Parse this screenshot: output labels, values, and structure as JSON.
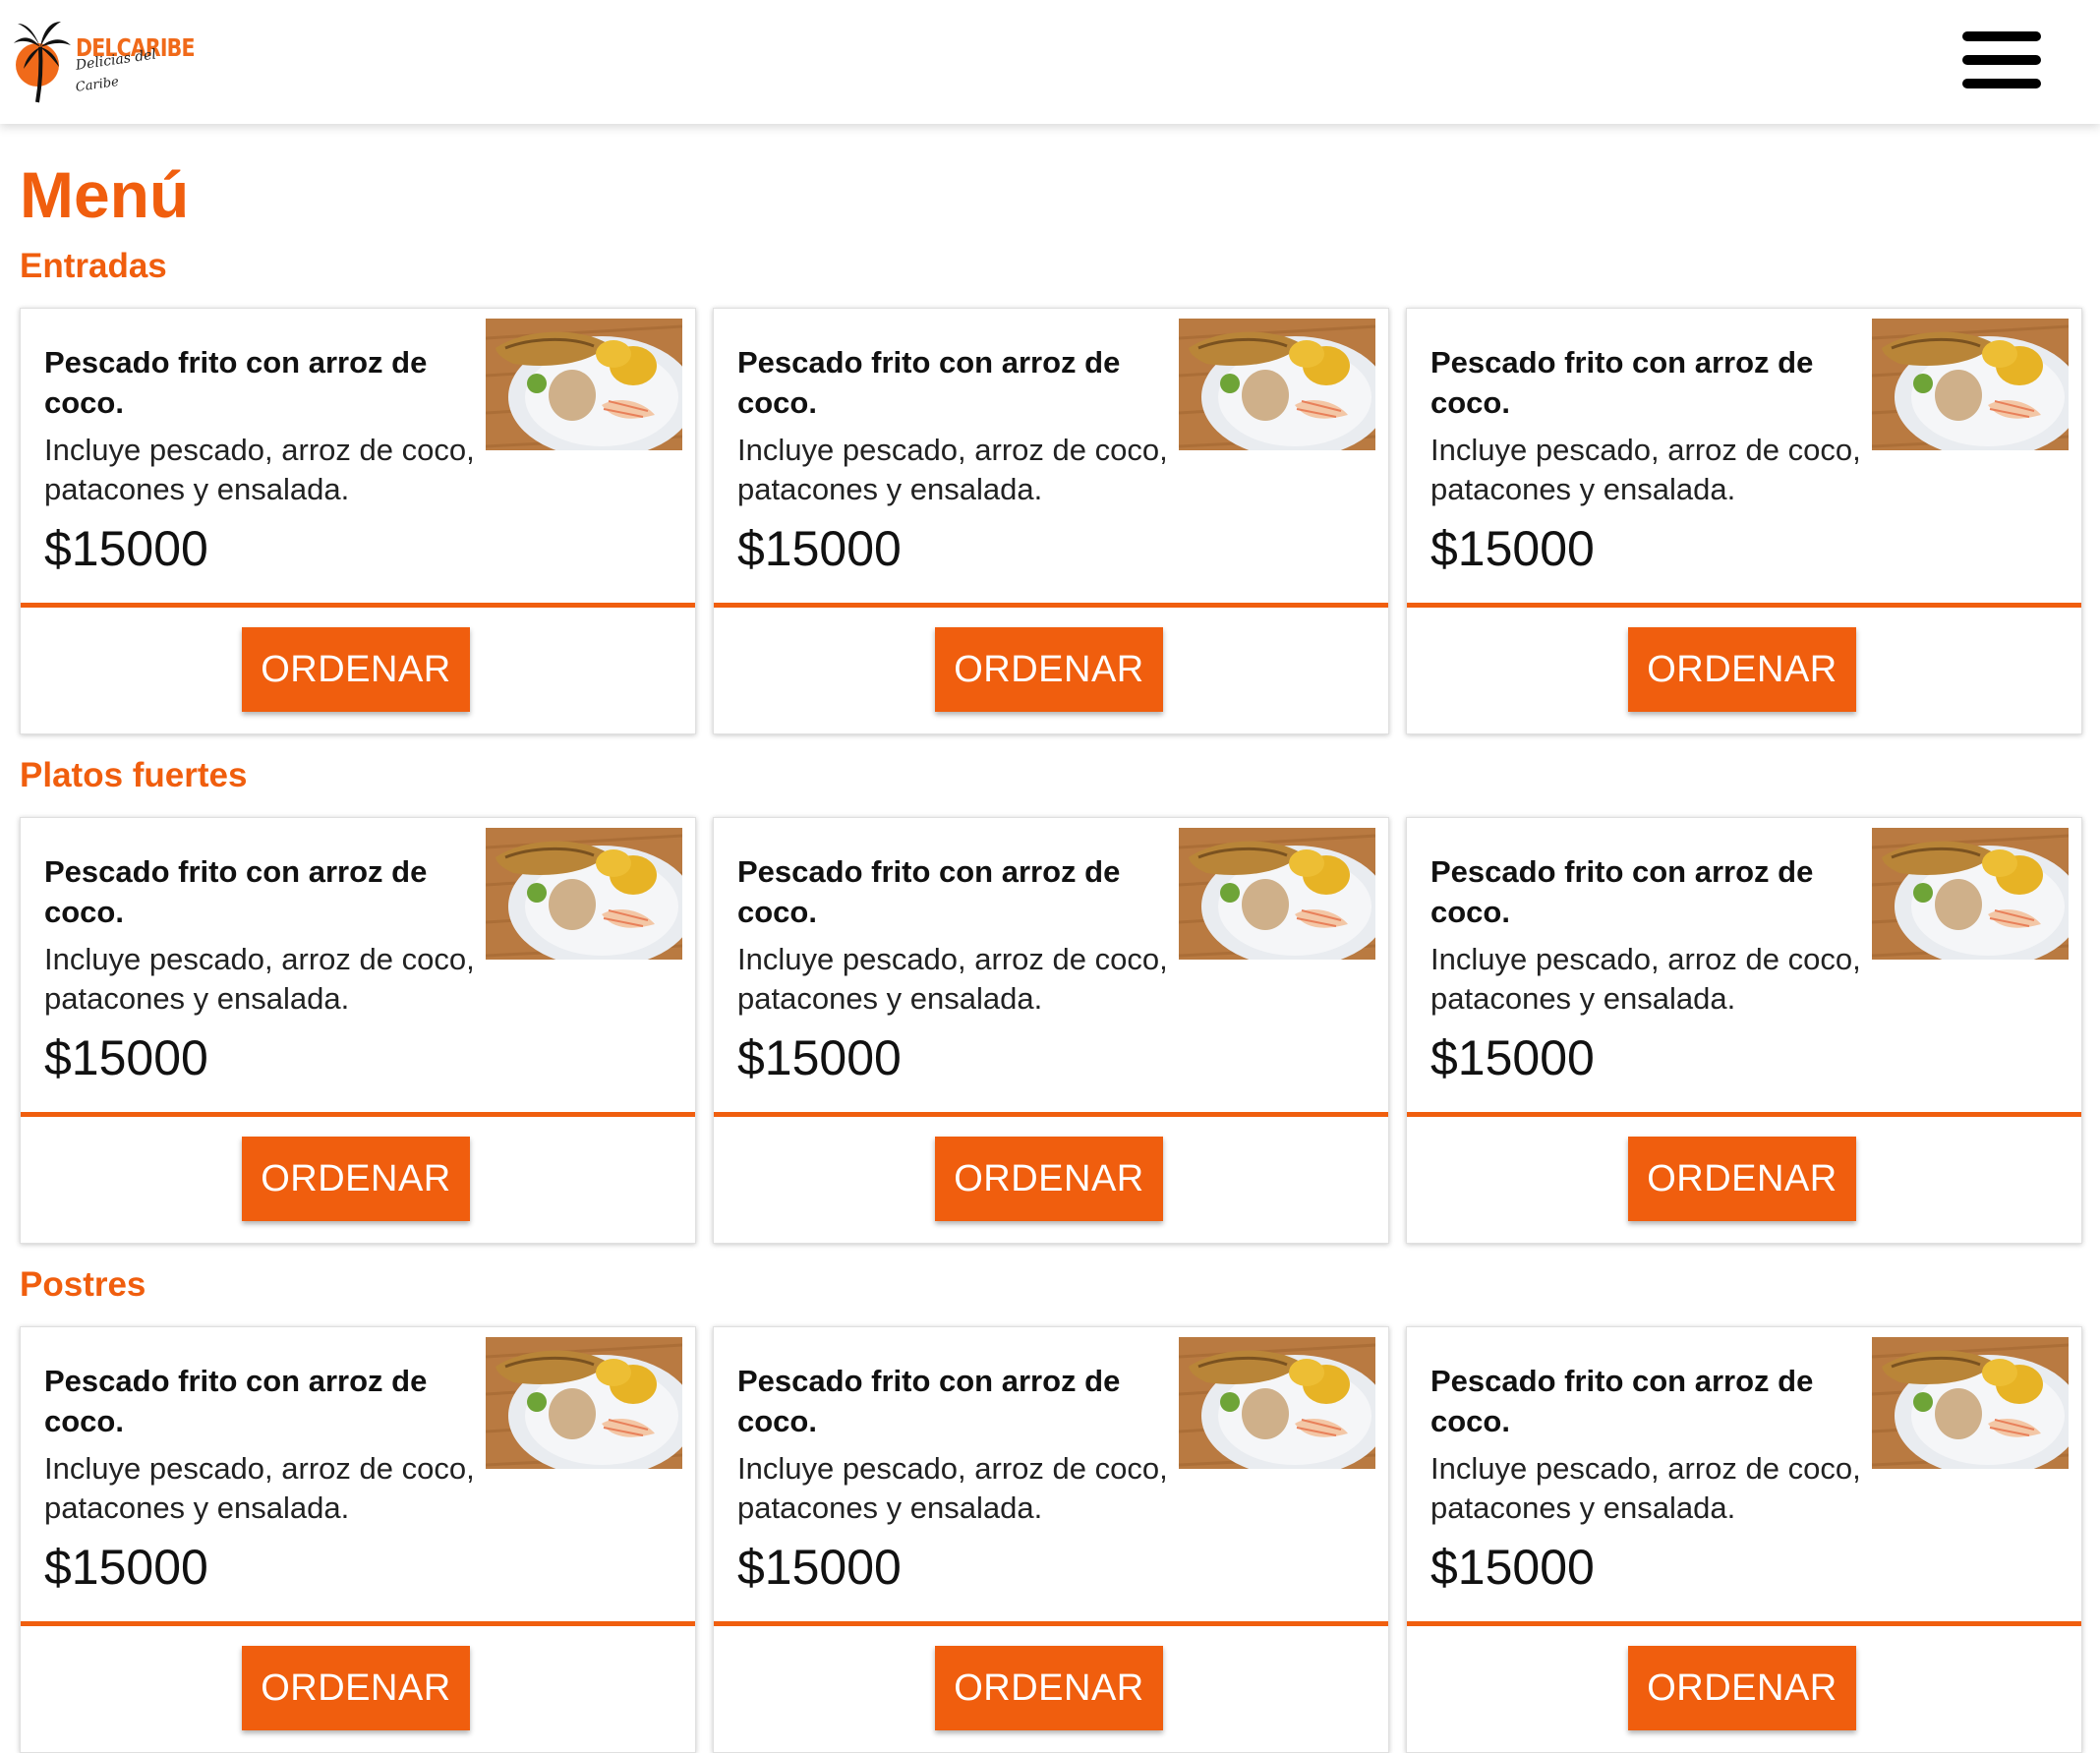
{
  "header": {
    "logo": {
      "brand": "DELCARIBE",
      "tagline_line1": "Delicias del",
      "tagline_line2": "Caribe"
    },
    "menu_icon": "hamburger-icon"
  },
  "page": {
    "title": "Menú"
  },
  "colors": {
    "accent": "#f05e0e",
    "logo_orange": "#f06a1a"
  },
  "sections": [
    {
      "title": "Entradas",
      "items": [
        {
          "name": "Pescado frito con arroz de coco.",
          "description": "Incluye pescado, arroz de coco, patacones y ensalada.",
          "price": "$15000",
          "button": "ORDENAR"
        },
        {
          "name": "Pescado frito con arroz de coco.",
          "description": "Incluye pescado, arroz de coco, patacones y ensalada.",
          "price": "$15000",
          "button": "ORDENAR"
        },
        {
          "name": "Pescado frito con arroz de coco.",
          "description": "Incluye pescado, arroz de coco, patacones y ensalada.",
          "price": "$15000",
          "button": "ORDENAR"
        }
      ]
    },
    {
      "title": "Platos fuertes",
      "items": [
        {
          "name": "Pescado frito con arroz de coco.",
          "description": "Incluye pescado, arroz de coco, patacones y ensalada.",
          "price": "$15000",
          "button": "ORDENAR"
        },
        {
          "name": "Pescado frito con arroz de coco.",
          "description": "Incluye pescado, arroz de coco, patacones y ensalada.",
          "price": "$15000",
          "button": "ORDENAR"
        },
        {
          "name": "Pescado frito con arroz de coco.",
          "description": "Incluye pescado, arroz de coco, patacones y ensalada.",
          "price": "$15000",
          "button": "ORDENAR"
        }
      ]
    },
    {
      "title": "Postres",
      "items": [
        {
          "name": "Pescado frito con arroz de coco.",
          "description": "Incluye pescado, arroz de coco, patacones y ensalada.",
          "price": "$15000",
          "button": "ORDENAR"
        },
        {
          "name": "Pescado frito con arroz de coco.",
          "description": "Incluye pescado, arroz de coco, patacones y ensalada.",
          "price": "$15000",
          "button": "ORDENAR"
        },
        {
          "name": "Pescado frito con arroz de coco.",
          "description": "Incluye pescado, arroz de coco, patacones y ensalada.",
          "price": "$15000",
          "button": "ORDENAR"
        }
      ]
    }
  ]
}
